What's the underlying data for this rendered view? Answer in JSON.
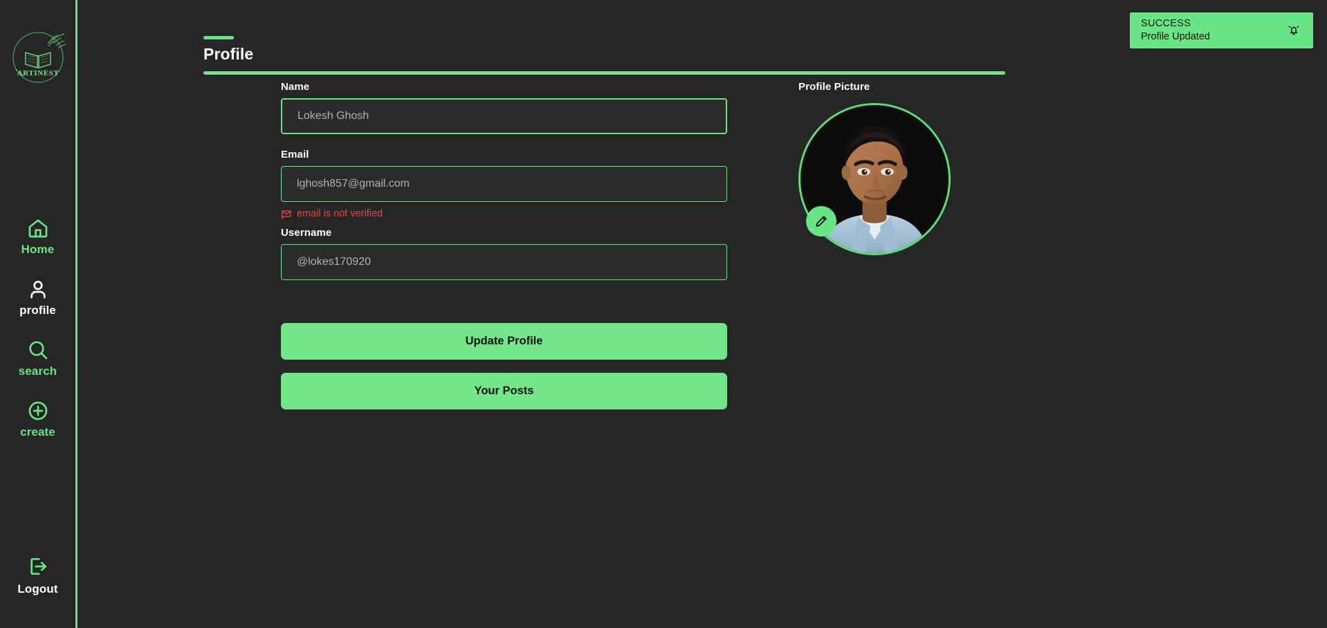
{
  "brand": {
    "name": "ARTINEST",
    "logo_icon": "artinest-book-logo"
  },
  "sidebar": {
    "items": [
      {
        "label": "Home",
        "icon": "home-icon",
        "state": "accent"
      },
      {
        "label": "profile",
        "icon": "user-icon",
        "state": "active"
      },
      {
        "label": "search",
        "icon": "search-icon",
        "state": "accent"
      },
      {
        "label": "create",
        "icon": "plus-circle-icon",
        "state": "accent"
      }
    ],
    "logout": {
      "label": "Logout",
      "icon": "logout-icon"
    }
  },
  "page": {
    "title": "Profile"
  },
  "form": {
    "name": {
      "label": "Name",
      "value": "Lokesh Ghosh",
      "placeholder": "Name"
    },
    "email": {
      "label": "Email",
      "value": "lghosh857@gmail.com",
      "placeholder": "Email",
      "error_text": "email is not verified",
      "error_icon": "mail-x-icon"
    },
    "username": {
      "label": "Username",
      "value": "@lokes170920",
      "placeholder": "Username"
    },
    "update_button": "Update Profile",
    "posts_button": "Your Posts"
  },
  "profile_picture": {
    "label": "Profile Picture",
    "edit_icon": "pencil-icon",
    "avatar": "user-photo"
  },
  "toast": {
    "title": "SUCCESS",
    "message": "Profile Updated",
    "icon": "bell-ring-icon"
  },
  "colors": {
    "accent": "#6ae585",
    "background": "#262626",
    "error": "#ef4444",
    "text": "#ffffff",
    "input_text": "#b0b0b0"
  }
}
